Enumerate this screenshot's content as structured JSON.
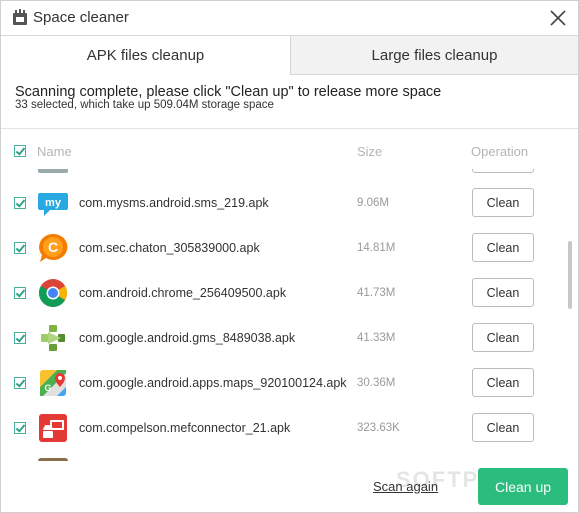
{
  "window": {
    "title": "Space cleaner"
  },
  "tabs": [
    {
      "label": "APK files cleanup",
      "active": true
    },
    {
      "label": "Large files cleanup",
      "active": false
    }
  ],
  "status": {
    "message": "Scanning complete, please click \"Clean up\" to release more space",
    "summary": "33 selected, which take up 509.04M storage space"
  },
  "columns": {
    "name": "Name",
    "size": "Size",
    "operation": "Operation"
  },
  "rows": [
    {
      "name": "com.mysms.android.sms_219.apk",
      "size": "9.06M",
      "action": "Clean",
      "icon": "mysms-icon",
      "checked": true
    },
    {
      "name": "com.sec.chaton_305839000.apk",
      "size": "14.81M",
      "action": "Clean",
      "icon": "chaton-icon",
      "checked": true
    },
    {
      "name": "com.android.chrome_256409500.apk",
      "size": "41.73M",
      "action": "Clean",
      "icon": "chrome-icon",
      "checked": true
    },
    {
      "name": "com.google.android.gms_8489038.apk",
      "size": "41.33M",
      "action": "Clean",
      "icon": "play-services-icon",
      "checked": true
    },
    {
      "name": "com.google.android.apps.maps_920100124.apk",
      "size": "30.36M",
      "action": "Clean",
      "icon": "google-maps-icon",
      "checked": true
    },
    {
      "name": "com.compelson.mefconnector_21.apk",
      "size": "323.63K",
      "action": "Clean",
      "icon": "mefconnector-icon",
      "checked": true
    }
  ],
  "footer": {
    "scan_again": "Scan again",
    "clean_up": "Clean up"
  },
  "watermark": "SOFTPEDIA",
  "colors": {
    "accent": "#2bbd7e",
    "checkbox": "#2ea58a"
  }
}
